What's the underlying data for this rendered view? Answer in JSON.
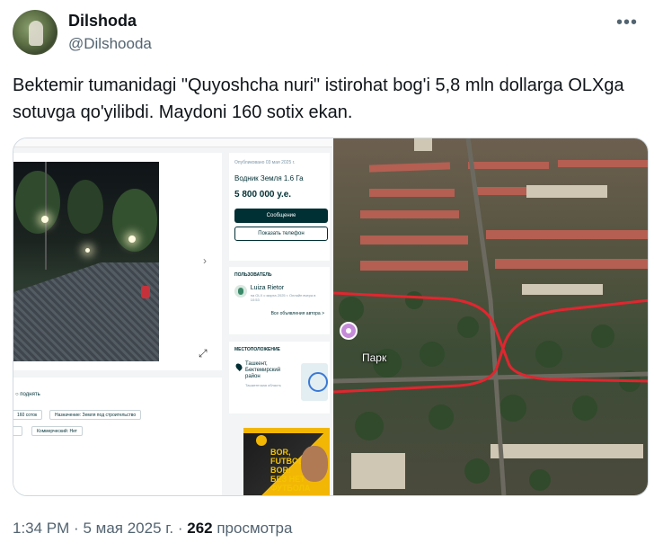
{
  "author": {
    "name": "Dilshoda",
    "handle": "@Dilshooda"
  },
  "tweet": {
    "text": "Bektemir tumanidagi \"Quyoshcha nuri\" istirohat bog'i 5,8 mln dollarga OLXga sotuvga qo'yilibdi. Maydoni 160 sotix ekan."
  },
  "listing": {
    "published": "Опубликовано 03 мая 2025 г.",
    "title": "Водник Земля 1.6 Га",
    "price": "5 800 000 у.е.",
    "message_button": "Сообщение",
    "phone_button": "Показать телефон",
    "raise_label": "поднять",
    "tags": [
      "160 соток",
      "Назначение: Земля под строительство",
      "Коммерческий: Нет"
    ]
  },
  "seller": {
    "section_title": "ПОЛЬЗОВАТЕЛЬ",
    "name": "Luiza Rietor",
    "meta": "на OLX с марта 2025 г. Онлайн вчера в 10:53",
    "all_ads_link": "Все объявления автора >"
  },
  "location": {
    "section_title": "МЕСТОПОЛОЖЕНИЕ",
    "city": "Ташкент, Бектемирский район",
    "region": "Ташкентская область"
  },
  "banner": {
    "text": "BOR, FUTBOL BOR! БЕЗ НЕТ ФУТБОЛА"
  },
  "map": {
    "place_label": "Парк",
    "route_color": "#e0262f"
  },
  "footer": {
    "time": "1:34 PM",
    "separator": "·",
    "date": "5 мая 2025 г.",
    "views_count": "262",
    "views_label": "просмотра"
  },
  "icons": {
    "more": "more-horizontal-icon",
    "expand": "expand-icon",
    "next": "chevron-right-icon",
    "place_pin": "location-pin-icon"
  }
}
